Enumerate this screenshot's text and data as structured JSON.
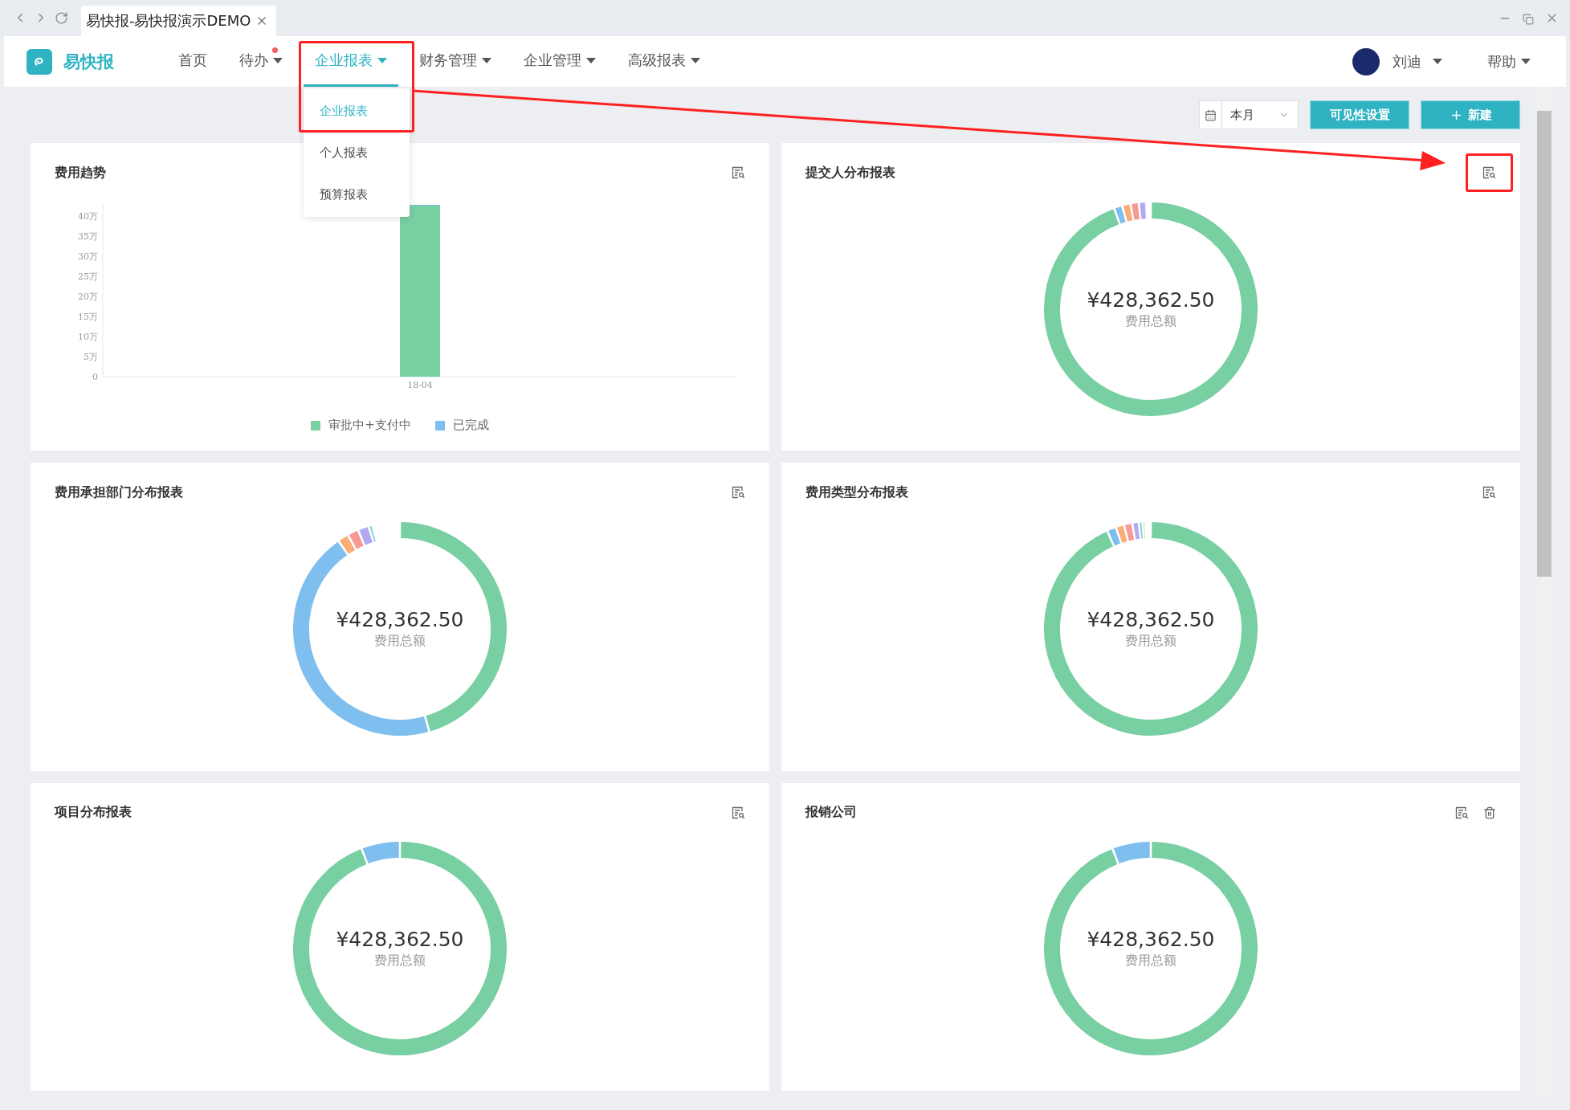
{
  "browser": {
    "tab_title": "易快报-易快报演示DEMO"
  },
  "app": {
    "logo_text": "易快报"
  },
  "nav": [
    {
      "label": "首页",
      "selected": false,
      "caret": false,
      "badge": false,
      "highlighted": false
    },
    {
      "label": "待办",
      "selected": false,
      "caret": true,
      "badge": true,
      "highlighted": false
    },
    {
      "label": "企业报表",
      "selected": true,
      "caret": true,
      "badge": false,
      "highlighted": true
    },
    {
      "label": "财务管理",
      "selected": false,
      "caret": true,
      "badge": false,
      "highlighted": false
    },
    {
      "label": "企业管理",
      "selected": false,
      "caret": true,
      "badge": false,
      "highlighted": false
    },
    {
      "label": "高级报表",
      "selected": false,
      "caret": true,
      "badge": false,
      "highlighted": false
    }
  ],
  "dropdown_menu": [
    {
      "label": "企业报表",
      "selected": true
    },
    {
      "label": "个人报表",
      "selected": false
    },
    {
      "label": "预算报表",
      "selected": false
    }
  ],
  "user": {
    "name": "刘迪"
  },
  "help": {
    "label": "帮助"
  },
  "toolbar": {
    "period": "本月",
    "buttons": [
      {
        "label": "可见性设置"
      },
      {
        "label": "新建"
      }
    ]
  },
  "cards": [
    {
      "kind": "bar",
      "title": "费用趋势",
      "highlighted": false,
      "deletable": false,
      "chart_data": {
        "type": "bar",
        "categories": [
          "18-04"
        ],
        "stacked": true,
        "series": [
          {
            "name": "审批中+支付中",
            "color": "#78cfa2",
            "values": [
              42.6
            ]
          },
          {
            "name": "已完成",
            "color": "#7fbff0",
            "values": [
              0.2
            ]
          }
        ],
        "ylim": [
          0,
          43
        ],
        "yticks": [
          {
            "value": 0,
            "label": "0"
          },
          {
            "value": 5,
            "label": "5万"
          },
          {
            "value": 10,
            "label": "10万"
          },
          {
            "value": 15,
            "label": "15万"
          },
          {
            "value": 20,
            "label": "20万"
          },
          {
            "value": 25,
            "label": "25万"
          },
          {
            "value": 30,
            "label": "30万"
          },
          {
            "value": 35,
            "label": "35万"
          },
          {
            "value": 40,
            "label": "40万"
          }
        ]
      }
    },
    {
      "kind": "donut",
      "title": "提交人分布报表",
      "amount": "¥428,362.50",
      "caption": "费用总额",
      "highlighted": true,
      "deletable": false
    },
    {
      "kind": "donut",
      "title": "费用承担部门分布报表",
      "amount": "¥428,362.50",
      "caption": "费用总额",
      "highlighted": false,
      "deletable": false
    },
    {
      "kind": "donut",
      "title": "费用类型分布报表",
      "amount": "¥428,362.50",
      "caption": "费用总额",
      "highlighted": false,
      "deletable": false
    },
    {
      "kind": "donut",
      "title": "项目分布报表",
      "amount": "¥428,362.50",
      "caption": "费用总额",
      "highlighted": false,
      "deletable": false
    },
    {
      "kind": "donut",
      "title": "报销公司",
      "amount": "¥428,362.50",
      "caption": "费用总额",
      "highlighted": false,
      "deletable": true
    }
  ]
}
